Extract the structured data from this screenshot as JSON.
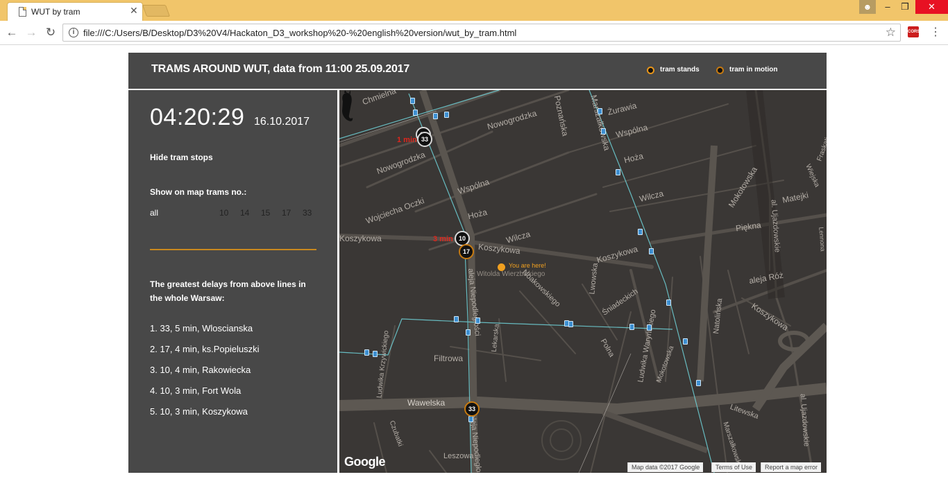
{
  "browser": {
    "tab_title": "WUT by tram",
    "tab_close": "✕",
    "url": "file:///C:/Users/B/Desktop/D3%20V4/Hackaton_D3_workshop%20-%20english%20version/wut_by_tram.html",
    "extension_label": "CORS",
    "window_buttons": {
      "minimize": "–",
      "maximize": "❐",
      "close": "✕"
    },
    "nav": {
      "back": "←",
      "forward": "→",
      "reload": "↻",
      "star": "☆",
      "menu": "⋮",
      "info": "i"
    }
  },
  "header": {
    "title": "TRAMS AROUND WUT, data from 11:00 25.09.2017",
    "legend": [
      {
        "label": "tram stands"
      },
      {
        "label": "tram in motion"
      }
    ]
  },
  "sidebar": {
    "clock": "04:20:29",
    "date": "16.10.2017",
    "hide_stops": "Hide tram stops",
    "show_label": "Show on map trams no.:",
    "filters": [
      "all",
      "10",
      "14",
      "15",
      "17",
      "33"
    ],
    "delays_title": "The greatest delays from above lines in the whole Warsaw:",
    "delays": [
      "1. 33, 5 min, Wloscianska",
      "2. 17, 4 min, ks.Popieluszki",
      "3. 10, 4 min, Rakowiecka",
      "4. 10, 3 min, Fort Wola",
      "5. 10, 3 min, Koszykowa"
    ]
  },
  "map": {
    "street_labels": [
      "Chmielna",
      "Poznańska",
      "Marszałkowska",
      "Żurawia",
      "Nowogrodzka",
      "Wspólna",
      "Nowogrodzka",
      "Hoża",
      "Wspólna",
      "Hoża",
      "Wilcza",
      "Mokotowska",
      "Matejki",
      "Wojciecha Oczki",
      "Wilcza",
      "Piękna",
      "Koszykowa",
      "Koszykowa",
      "Koszykowa",
      "aleja Niepodległości",
      "Witolda Wierzbickiego",
      "Noakowskiego",
      "Lwowska",
      "Śniadeckich",
      "Ludwika Waryńskiego",
      "aleja Róż",
      "Natolińska",
      "Koszykowa",
      "Lekarska",
      "Polna",
      "Filtrowa",
      "Ludwika Krzywickiego",
      "Mokotowska",
      "Wawelska",
      "Litewska",
      "Czubatki",
      "Leszowa",
      "aleja Niepodległości",
      "Marszałkowska",
      "al. Ujazdowskie",
      "al. Ujazdowskie",
      "Fraskati",
      "Wiejska",
      "Lennona"
    ],
    "trams": [
      {
        "line": "10",
        "type": "stand"
      },
      {
        "line": "33",
        "type": "stand"
      },
      {
        "line": "10",
        "type": "stand"
      },
      {
        "line": "17",
        "type": "motion"
      },
      {
        "line": "33",
        "type": "motion"
      }
    ],
    "etas": [
      "1 min",
      "3 min"
    ],
    "you_are_here": "You are here!",
    "google": "Google",
    "footer": [
      "Map data ©2017 Google",
      "Terms of Use",
      "Report a map error"
    ]
  },
  "colors": {
    "panel": "#484848",
    "accent": "#c9891e",
    "map_bg": "#3a3735",
    "eta_red": "#e0261c",
    "chrome": "#f1c56a"
  }
}
